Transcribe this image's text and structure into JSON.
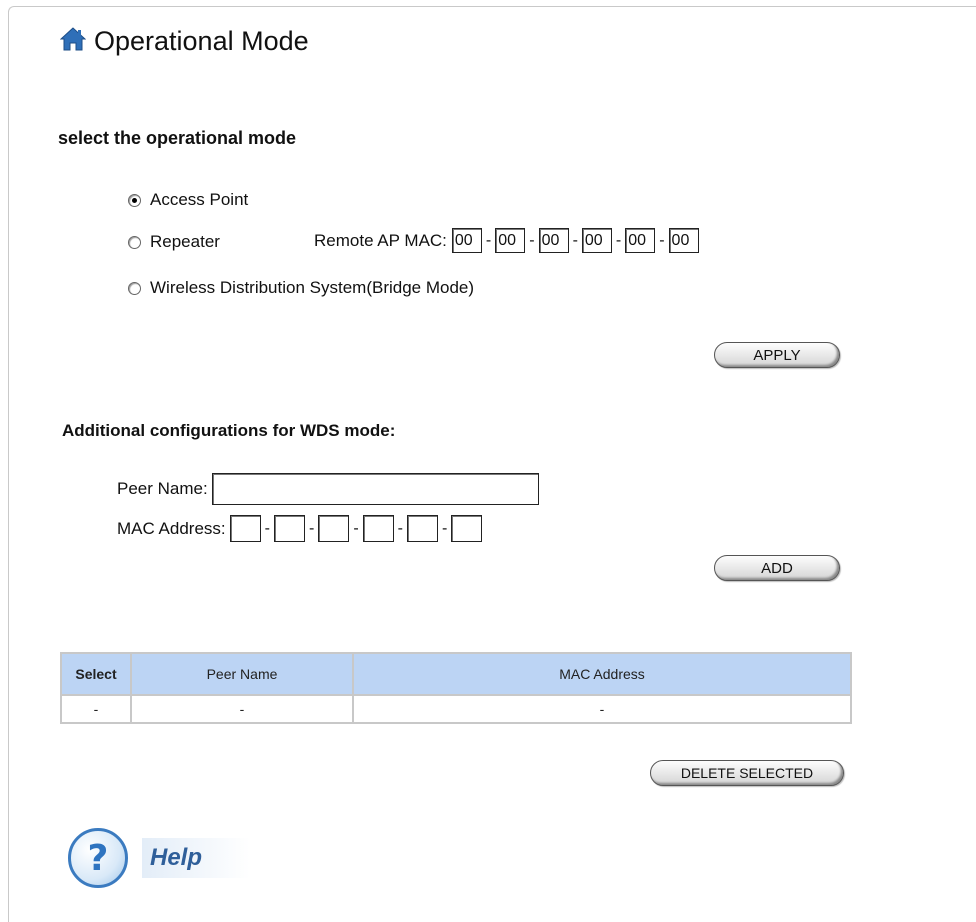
{
  "header": {
    "title": "Operational Mode",
    "icon": "home-icon"
  },
  "mode": {
    "heading": "select the operational mode",
    "options": [
      {
        "label": "Access Point",
        "checked": true
      },
      {
        "label": "Repeater",
        "checked": false
      },
      {
        "label": "Wireless Distribution System(Bridge Mode)",
        "checked": false
      }
    ],
    "remote_mac_label": "Remote AP MAC:",
    "remote_mac": [
      "00",
      "00",
      "00",
      "00",
      "00",
      "00"
    ],
    "apply_label": "APPLY"
  },
  "wds": {
    "heading": "Additional configurations for WDS mode:",
    "peer_name_label": "Peer Name:",
    "peer_name_value": "",
    "mac_label": "MAC Address:",
    "mac": [
      "",
      "",
      "",
      "",
      "",
      ""
    ],
    "add_label": "ADD"
  },
  "table": {
    "headers": [
      "Select",
      "Peer Name",
      "MAC Address"
    ],
    "rows": [
      [
        "-",
        "-",
        "-"
      ]
    ]
  },
  "delete_label": "DELETE SELECTED",
  "help": {
    "label": "Help",
    "icon": "help-icon"
  },
  "colors": {
    "table_header": "#bcd4f4",
    "help_text": "#2f5f9a",
    "home_icon": "#2f6fb8"
  }
}
